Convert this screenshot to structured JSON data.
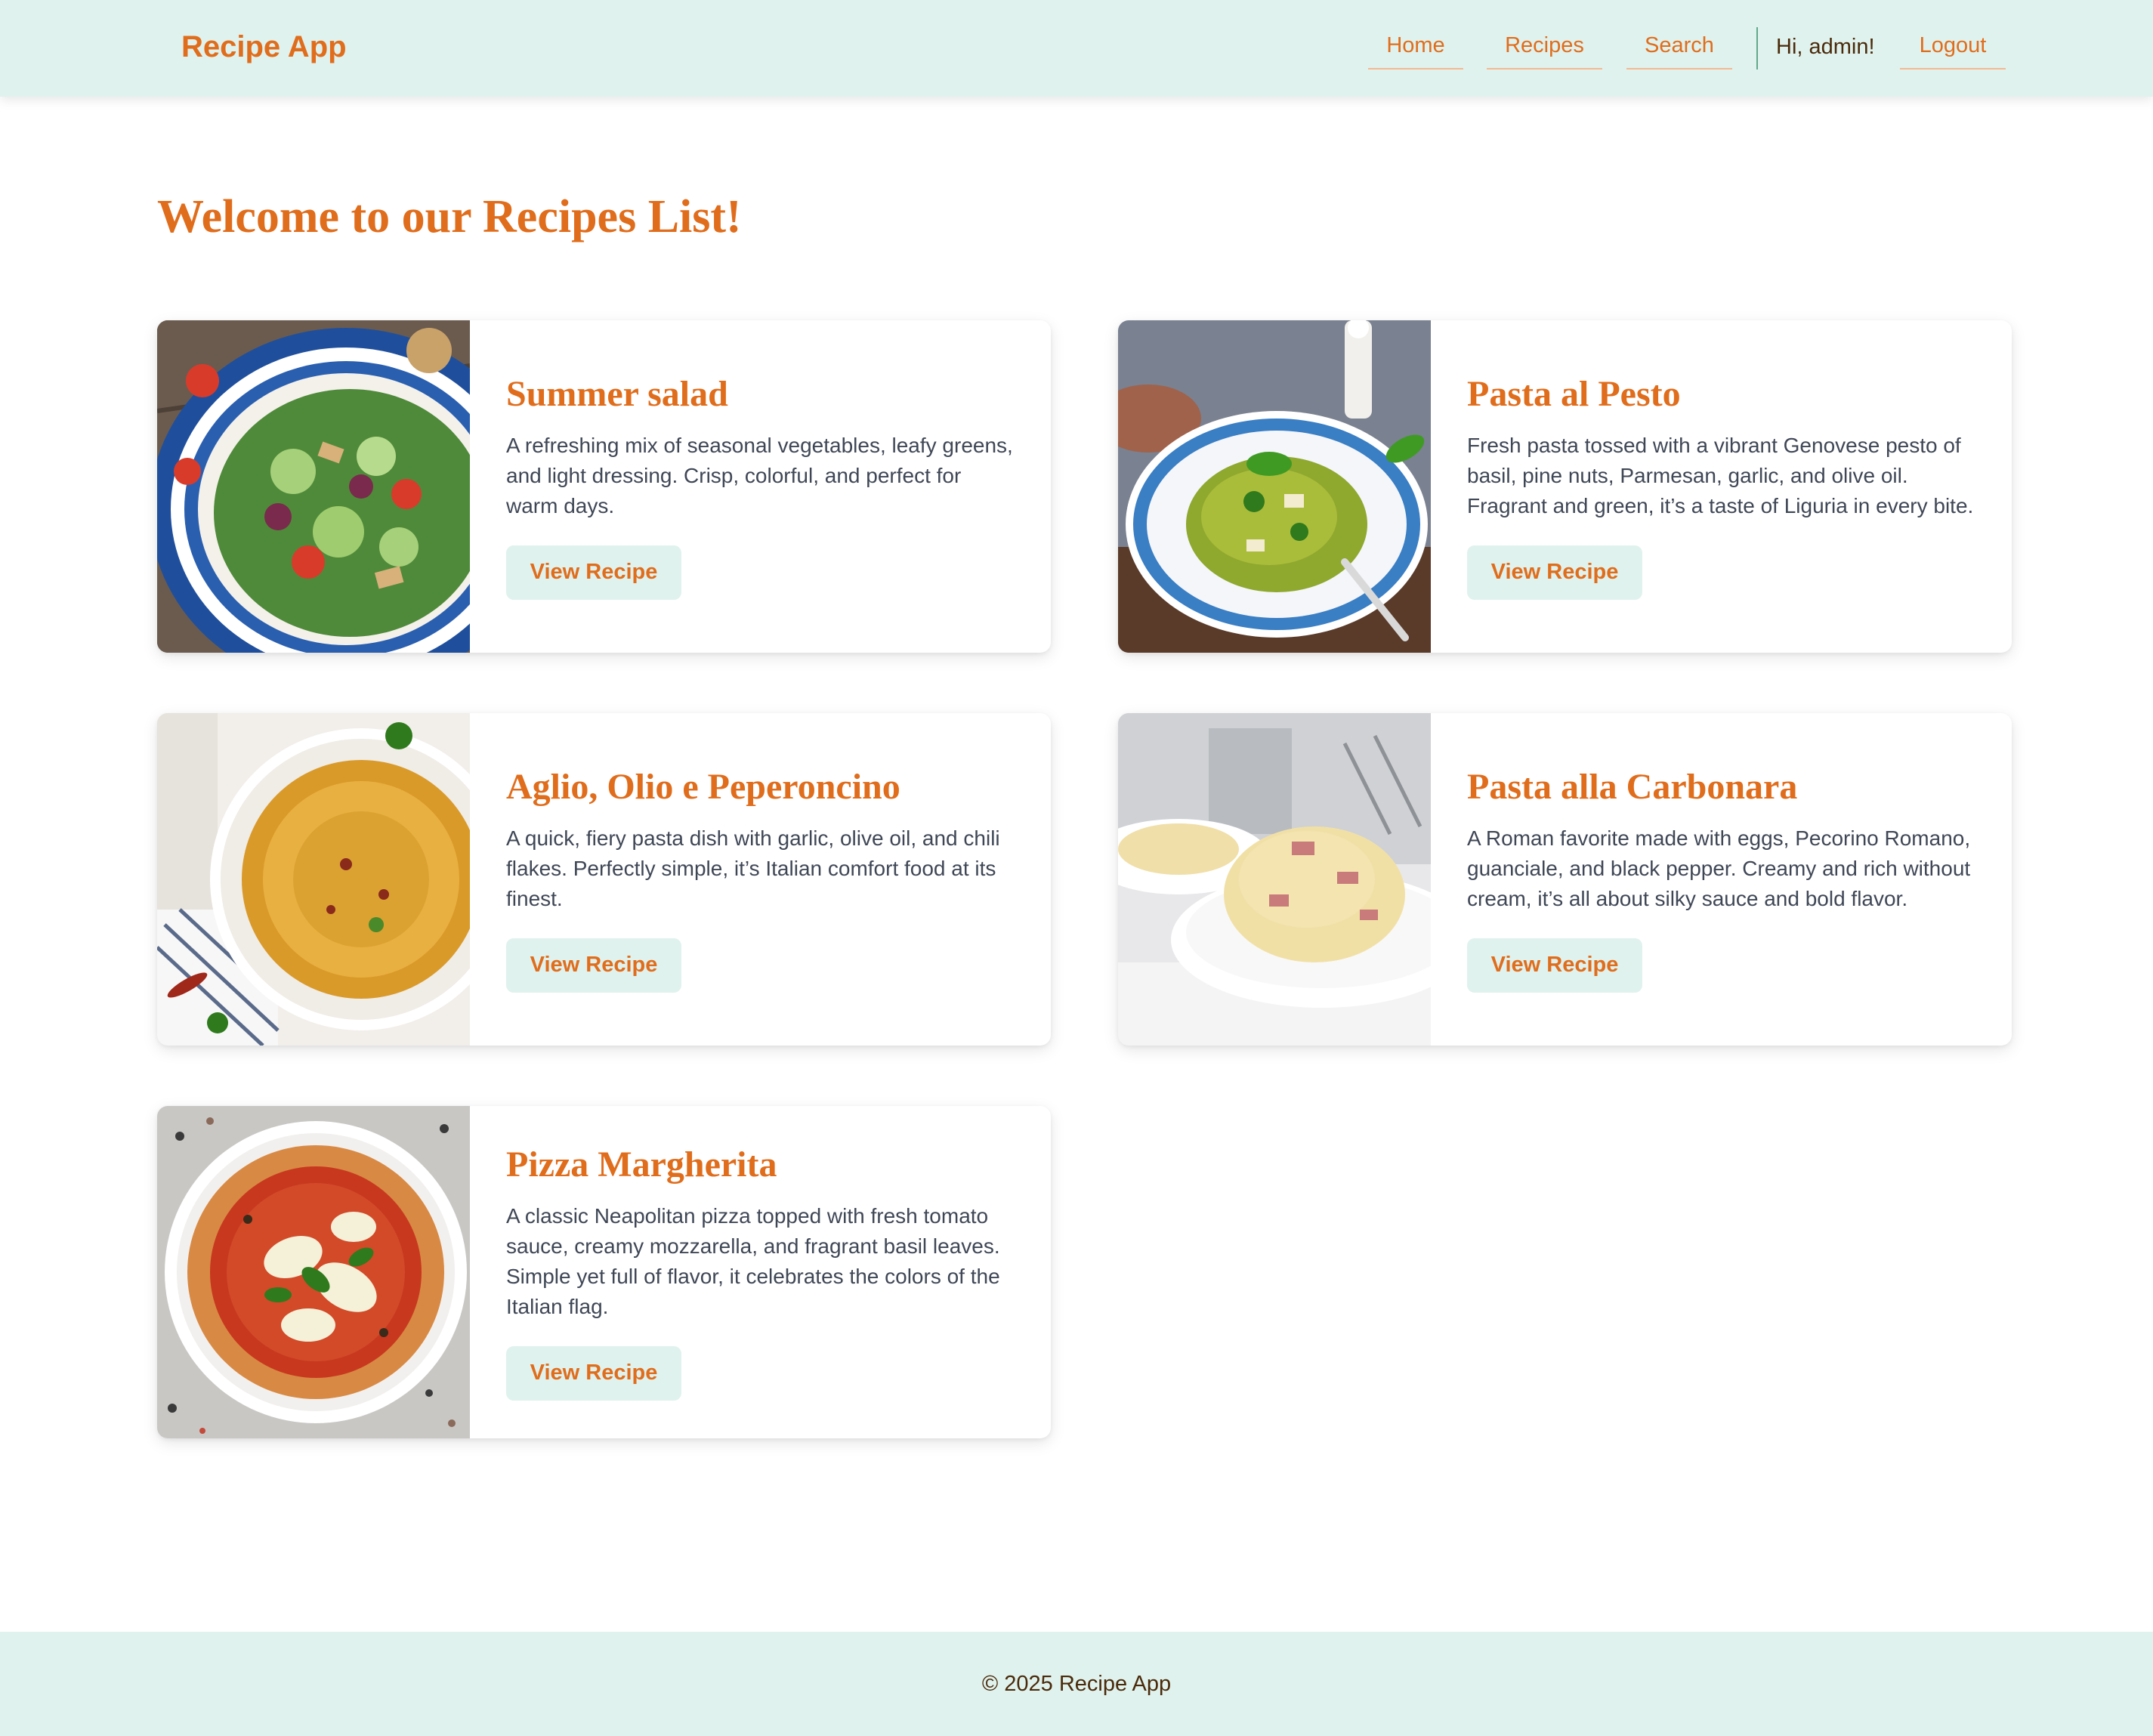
{
  "header": {
    "brand": "Recipe App",
    "nav": {
      "home": "Home",
      "recipes": "Recipes",
      "search": "Search",
      "greeting": "Hi, admin!",
      "logout": "Logout"
    }
  },
  "main": {
    "title": "Welcome to our Recipes List!",
    "recipes": [
      {
        "title": "Summer salad",
        "description": "A refreshing mix of seasonal vegetables, leafy greens, and light dressing. Crisp, colorful, and perfect for warm days.",
        "button": "View Recipe",
        "image_icon": "salad-photo"
      },
      {
        "title": "Pasta al Pesto",
        "description": "Fresh pasta tossed with a vibrant Genovese pesto of basil, pine nuts, Parmesan, garlic, and olive oil. Fragrant and green, it’s a taste of Liguria in every bite.",
        "button": "View Recipe",
        "image_icon": "pesto-pasta-photo"
      },
      {
        "title": "Aglio, Olio e Peperoncino",
        "description": "A quick, fiery pasta dish with garlic, olive oil, and chili flakes. Perfectly simple, it’s Italian comfort food at its finest.",
        "button": "View Recipe",
        "image_icon": "spaghetti-photo"
      },
      {
        "title": "Pasta alla Carbonara",
        "description": "A Roman favorite made with eggs, Pecorino Romano, guanciale, and black pepper. Creamy and rich without cream, it’s all about silky sauce and bold flavor.",
        "button": "View Recipe",
        "image_icon": "carbonara-photo"
      },
      {
        "title": "Pizza Margherita",
        "description": "A classic Neapolitan pizza topped with fresh tomato sauce, creamy mozzarella, and fragrant basil leaves. Simple yet full of flavor, it celebrates the colors of the Italian flag.",
        "button": "View Recipe",
        "image_icon": "pizza-photo"
      }
    ]
  },
  "footer": {
    "text": "© 2025 Recipe App"
  },
  "colors": {
    "accent": "#e06d1c",
    "header_bg": "#e0f2ee",
    "text": "#3f4756"
  }
}
